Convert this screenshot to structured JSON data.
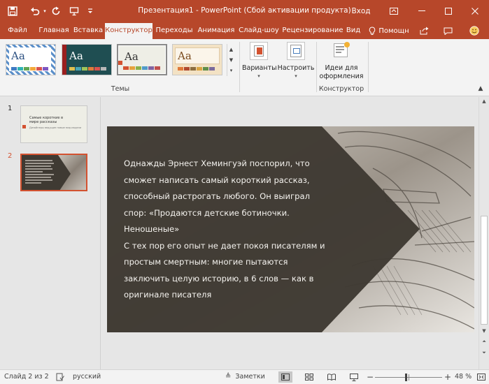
{
  "window": {
    "title": "Презентация1  -  PowerPoint (Сбой активации продукта)",
    "signin": "Вход"
  },
  "tabs": [
    {
      "label": "Файл"
    },
    {
      "label": "Главная"
    },
    {
      "label": "Вставка"
    },
    {
      "label": "Конструктор",
      "active": true
    },
    {
      "label": "Переходы"
    },
    {
      "label": "Анимация"
    },
    {
      "label": "Слайд-шоу"
    },
    {
      "label": "Рецензирование"
    },
    {
      "label": "Вид"
    },
    {
      "label": "Помощн"
    }
  ],
  "ribbon": {
    "themes_label": "Темы",
    "variants_label": "Варианты",
    "customize_label": "Настроить",
    "design_ideas_line1": "Идеи для",
    "design_ideas_line2": "оформления",
    "designer_group_label": "Конструктор",
    "theme_sample": "Aa"
  },
  "thumbnails": [
    {
      "number": "1",
      "title": "Самые короткие в мире рассказы",
      "subtitle": "Дизайнеры ведущие новые мир-модели"
    },
    {
      "number": "2",
      "selected": true
    }
  ],
  "slide": {
    "text": "Однажды Эрнест Хемингуэй поспорил, что сможет написать самый короткий рассказ, способный растрогать любого. Он выиграл спор: «Продаются детские ботиночки. Неношеные»\nС тех пор его опыт не дает покоя писателям и простым смертным: многие пытаются заключить целую историю, в 6 слов — как в оригинале писателя"
  },
  "statusbar": {
    "slide_info": "Слайд 2 из 2",
    "language": "русский",
    "notes_label": "Заметки",
    "zoom": "48 %"
  },
  "colors": {
    "accent": "#b7472a",
    "slide_shape": "#3f3a33"
  }
}
